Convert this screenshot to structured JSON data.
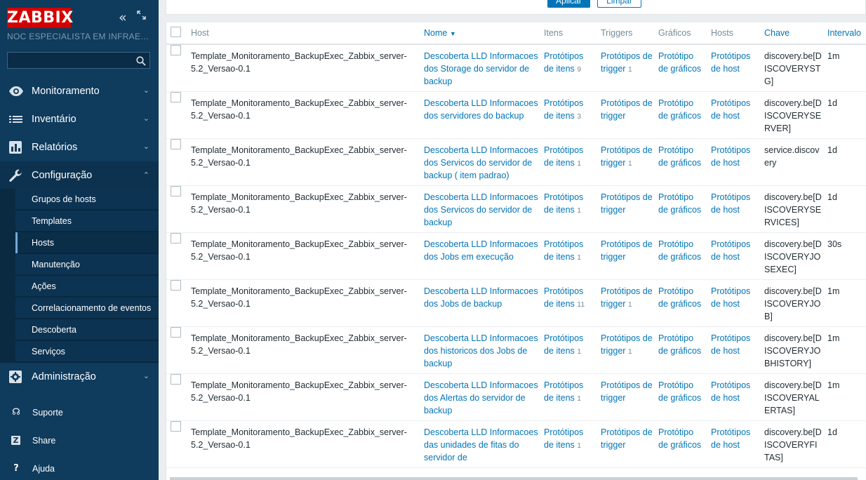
{
  "sidebar": {
    "logo": "ZABBIX",
    "server_name": "NOC ESPECIALISTA EM INFRAESTRUTURA",
    "search_value": "",
    "menu": [
      {
        "label": "Monitoramento",
        "icon": "eye-icon"
      },
      {
        "label": "Inventário",
        "icon": "list-icon"
      },
      {
        "label": "Relatórios",
        "icon": "bar-chart-icon"
      },
      {
        "label": "Configuração",
        "icon": "wrench-icon"
      },
      {
        "label": "Administração",
        "icon": "cog-icon"
      }
    ],
    "submenu": [
      "Grupos de hosts",
      "Templates",
      "Hosts",
      "Manutenção",
      "Ações",
      "Correlacionamento de eventos",
      "Descoberta",
      "Serviços"
    ],
    "bottom": [
      {
        "label": "Suporte",
        "icon": "headset-icon",
        "glyph": "☊"
      },
      {
        "label": "Share",
        "icon": "share-icon",
        "glyph": "Z"
      },
      {
        "label": "Ajuda",
        "icon": "help-icon",
        "glyph": "?"
      }
    ]
  },
  "filter": {
    "apply_label": "Aplicar",
    "reset_label": "Limpar"
  },
  "table": {
    "headers": {
      "host": "Host",
      "name": "Nome",
      "items": "Itens",
      "triggers": "Triggers",
      "graphs": "Gráficos",
      "hosts": "Hosts",
      "key": "Chave",
      "interval": "Intervalo"
    },
    "rows": [
      {
        "host": "Template_Monitoramento_BackupExec_Zabbix_server-5.2_Versao-0.1",
        "name": "Descoberta LLD Informacoes dos Storage do servidor de backup",
        "items_label": "Protótipos de itens",
        "items_count": "9",
        "triggers_label": "Protótipos de trigger",
        "triggers_count": "1",
        "graphs_label": "Protótipo de gráficos",
        "hosts_label": "Protótipos de host",
        "key": "discovery.be[DISCOVERYSTG]",
        "interval": "1m"
      },
      {
        "host": "Template_Monitoramento_BackupExec_Zabbix_server-5.2_Versao-0.1",
        "name": "Descoberta LLD Informacoes dos servidores do backup",
        "items_label": "Protótipos de itens",
        "items_count": "3",
        "triggers_label": "Protótipos de trigger",
        "triggers_count": "",
        "graphs_label": "Protótipo de gráficos",
        "hosts_label": "Protótipos de host",
        "key": "discovery.be[DISCOVERYSERVER]",
        "interval": "1d"
      },
      {
        "host": "Template_Monitoramento_BackupExec_Zabbix_server-5.2_Versao-0.1",
        "name": "Descoberta LLD Informacoes dos Servicos do servidor de backup ( item padrao)",
        "items_label": "Protótipos de itens",
        "items_count": "1",
        "triggers_label": "Protótipos de trigger",
        "triggers_count": "1",
        "graphs_label": "Protótipo de gráficos",
        "hosts_label": "Protótipos de host",
        "key": "service.discovery",
        "interval": "1d"
      },
      {
        "host": "Template_Monitoramento_BackupExec_Zabbix_server-5.2_Versao-0.1",
        "name": "Descoberta LLD Informacoes dos Servicos do servidor de backup",
        "items_label": "Protótipos de itens",
        "items_count": "1",
        "triggers_label": "Protótipos de trigger",
        "triggers_count": "",
        "graphs_label": "Protótipo de gráficos",
        "hosts_label": "Protótipos de host",
        "key": "discovery.be[DISCOVERYSERVICES]",
        "interval": "1d"
      },
      {
        "host": "Template_Monitoramento_BackupExec_Zabbix_server-5.2_Versao-0.1",
        "name": "Descoberta LLD Informacoes dos Jobs em execução",
        "items_label": "Protótipos de itens",
        "items_count": "1",
        "triggers_label": "Protótipos de trigger",
        "triggers_count": "",
        "graphs_label": "Protótipo de gráficos",
        "hosts_label": "Protótipos de host",
        "key": "discovery.be[DISCOVERYJOSEXEC]",
        "interval": "30s"
      },
      {
        "host": "Template_Monitoramento_BackupExec_Zabbix_server-5.2_Versao-0.1",
        "name": "Descoberta LLD Informacoes dos Jobs de backup",
        "items_label": "Protótipos de itens",
        "items_count": "11",
        "triggers_label": "Protótipos de trigger",
        "triggers_count": "1",
        "graphs_label": "Protótipo de gráficos",
        "hosts_label": "Protótipos de host",
        "key": "discovery.be[DISCOVERYJOB]",
        "interval": "1m"
      },
      {
        "host": "Template_Monitoramento_BackupExec_Zabbix_server-5.2_Versao-0.1",
        "name": "Descoberta LLD Informacoes dos historicos dos Jobs de backup",
        "items_label": "Protótipos de itens",
        "items_count": "1",
        "triggers_label": "Protótipos de trigger",
        "triggers_count": "1",
        "graphs_label": "Protótipo de gráficos",
        "hosts_label": "Protótipos de host",
        "key": "discovery.be[DISCOVERYJOBHISTORY]",
        "interval": "1m"
      },
      {
        "host": "Template_Monitoramento_BackupExec_Zabbix_server-5.2_Versao-0.1",
        "name": "Descoberta LLD Informacoes dos Alertas do servidor de backup",
        "items_label": "Protótipos de itens",
        "items_count": "1",
        "triggers_label": "Protótipos de trigger",
        "triggers_count": "",
        "graphs_label": "Protótipo de gráficos",
        "hosts_label": "Protótipos de host",
        "key": "discovery.be[DISCOVERYALERTAS]",
        "interval": "1m"
      },
      {
        "host": "Template_Monitoramento_BackupExec_Zabbix_server-5.2_Versao-0.1",
        "name": "Descoberta LLD Informacoes das unidades de fitas do servidor de",
        "items_label": "Protótipos de itens",
        "items_count": "1",
        "triggers_label": "Protótipos de trigger",
        "triggers_count": "",
        "graphs_label": "Protótipo de gráficos",
        "hosts_label": "Protótipos de host",
        "key": "discovery.be[DISCOVERYFITAS]",
        "interval": "1d"
      }
    ]
  }
}
